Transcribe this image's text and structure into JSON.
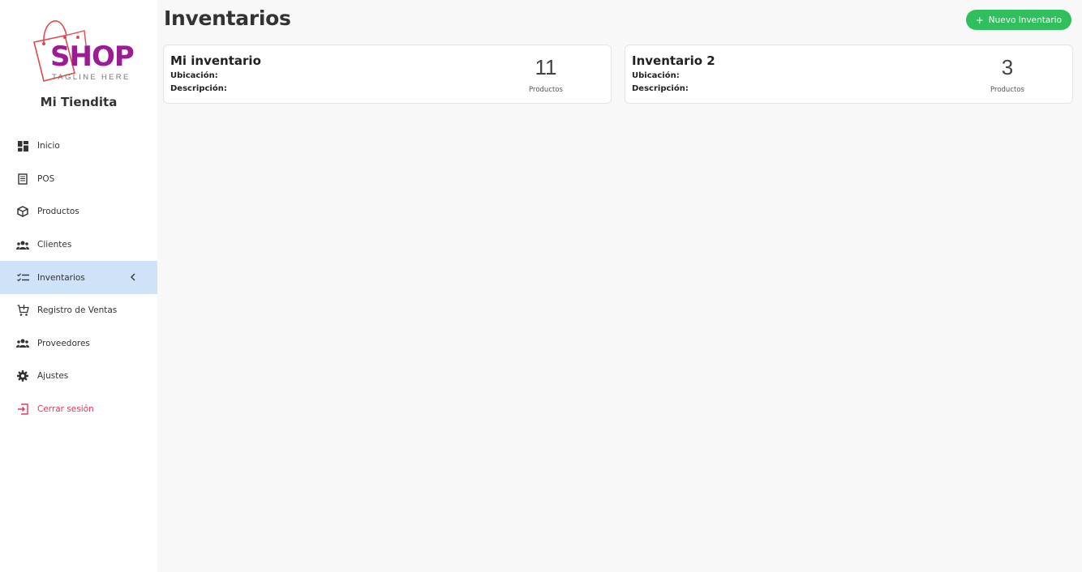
{
  "brand": {
    "logo_text": "SHOP",
    "tagline": "TAGLINE HERE",
    "store_name": "Mi Tiendita",
    "colors": {
      "logo_purple": "#9b1c93",
      "logo_bag": "#e5484d"
    }
  },
  "sidebar": {
    "items": [
      {
        "label": "Inicio",
        "icon": "dashboard-icon"
      },
      {
        "label": "POS",
        "icon": "receipt-icon"
      },
      {
        "label": "Productos",
        "icon": "box-icon"
      },
      {
        "label": "Clientes",
        "icon": "users-icon"
      },
      {
        "label": "Inventarios",
        "icon": "checklist-icon",
        "active": true
      },
      {
        "label": "Registro de Ventas",
        "icon": "cart-icon"
      },
      {
        "label": "Proveedores",
        "icon": "users-icon"
      },
      {
        "label": "Ajustes",
        "icon": "gear-icon"
      },
      {
        "label": "Cerrar sesión",
        "icon": "logout-icon"
      }
    ],
    "active_bg": "#cfe2f8",
    "logout_color": "#e6375c"
  },
  "header": {
    "title": "Inventarios",
    "new_button_label": "Nuevo Inventario",
    "new_button_color": "#2fbf5c"
  },
  "inventories": [
    {
      "name": "Mi inventario",
      "location_label": "Ubicación:",
      "description_label": "Descripción:",
      "count": "11",
      "count_unit": "Productos"
    },
    {
      "name": "Inventario 2",
      "location_label": "Ubicación:",
      "description_label": "Descripción:",
      "count": "3",
      "count_unit": "Productos"
    }
  ]
}
